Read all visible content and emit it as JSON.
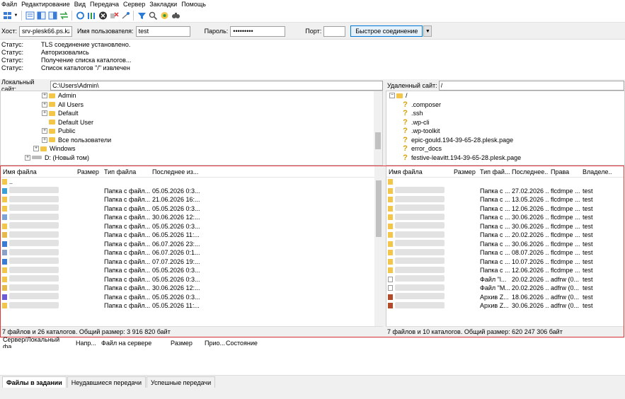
{
  "menu": [
    "Файл",
    "Редактирование",
    "Вид",
    "Передача",
    "Сервер",
    "Закладки",
    "Помощь"
  ],
  "toolbar_icons": [
    "site-manager-icon",
    "dropdown-icon",
    "toggle-log-icon",
    "toggle-local-tree-icon",
    "toggle-remote-tree-icon",
    "queue-icon",
    "refresh-icon",
    "process-queue-icon",
    "cancel-icon",
    "disconnect-icon",
    "reconnect-icon",
    "filter-icon",
    "compare-icon",
    "sync-browse-icon",
    "search-icon"
  ],
  "quickconnect": {
    "host_label": "Хост:",
    "host_value": "srv-plesk66.ps.kz",
    "user_label": "Имя пользователя:",
    "user_value": "test",
    "pass_label": "Пароль:",
    "pass_value": "•••••••••",
    "port_label": "Порт:",
    "port_value": "",
    "button": "Быстрое соединение"
  },
  "log": [
    {
      "k": "Статус:",
      "v": "TLS соединение установлено."
    },
    {
      "k": "Статус:",
      "v": "Авторизовались"
    },
    {
      "k": "Статус:",
      "v": "Получение списка каталогов..."
    },
    {
      "k": "Статус:",
      "v": "Список каталогов \"/\" извлечен"
    }
  ],
  "local": {
    "label": "Локальный сайт:",
    "path": "C:\\Users\\Admin\\",
    "tree": [
      {
        "t": "Admin",
        "indent": 58,
        "exp": "+"
      },
      {
        "t": "All Users",
        "indent": 58,
        "exp": "+"
      },
      {
        "t": "Default",
        "indent": 58,
        "exp": "+"
      },
      {
        "t": "Default User",
        "indent": 58,
        "exp": ""
      },
      {
        "t": "Public",
        "indent": 58,
        "exp": "+"
      },
      {
        "t": "Все пользователи",
        "indent": 58,
        "exp": "+"
      },
      {
        "t": "Windows",
        "indent": 46,
        "exp": "+"
      },
      {
        "t": "D: (Новый том)",
        "indent": 34,
        "exp": "+"
      }
    ],
    "headers": [
      "Имя файла",
      "Размер",
      "Тип файла",
      "Последнее из..."
    ],
    "rows": [
      {
        "type": "",
        "date": ""
      },
      {
        "type": "Папка с файл...",
        "date": "05.05.2026 0:3..."
      },
      {
        "type": "Папка с файл...",
        "date": "21.06.2026 16:..."
      },
      {
        "type": "Папка с файл...",
        "date": "05.05.2026 0:3..."
      },
      {
        "type": "Папка с файл...",
        "date": "30.06.2026 12:..."
      },
      {
        "type": "Папка с файл...",
        "date": "05.05.2026 0:3..."
      },
      {
        "type": "Папка с файл...",
        "date": "06.05.2026 11:..."
      },
      {
        "type": "Папка с файл...",
        "date": "06.07.2026 23:..."
      },
      {
        "type": "Папка с файл...",
        "date": "06.07.2026 0:1..."
      },
      {
        "type": "Папка с файл...",
        "date": "07.07.2026 19:..."
      },
      {
        "type": "Папка с файл...",
        "date": "05.05.2026 0:3..."
      },
      {
        "type": "Папка с файл...",
        "date": "05.05.2026 0:3..."
      },
      {
        "type": "Папка с файл...",
        "date": "30.06.2026 12:..."
      },
      {
        "type": "Папка с файл...",
        "date": "05.05.2026 0:3..."
      },
      {
        "type": "Папка с файл...",
        "date": "05.05.2026 11:..."
      }
    ],
    "first_row_name": "..",
    "summary": "7 файлов и 26 каталогов. Общий размер: 3 916 820 байт"
  },
  "remote": {
    "label": "Удаленный сайт:",
    "path": "/",
    "tree": [
      {
        "t": "/",
        "q": false
      },
      {
        "t": ".composer",
        "q": true
      },
      {
        "t": ".ssh",
        "q": true
      },
      {
        "t": ".wp-cli",
        "q": true
      },
      {
        "t": ".wp-toolkit",
        "q": true
      },
      {
        "t": "epic-gould.194-39-65-28.plesk.page",
        "q": true
      },
      {
        "t": "error_docs",
        "q": true
      },
      {
        "t": "festive-leavitt.194-39-65-28.plesk.page",
        "q": true
      }
    ],
    "headers": [
      "Имя файла",
      "Размер",
      "Тип фай...",
      "Последнее...",
      "Права",
      "Владеле..."
    ],
    "rows": [
      {
        "type": "",
        "date": "",
        "perm": "",
        "own": ""
      },
      {
        "type": "Папка с ...",
        "date": "27.02.2026 ...",
        "perm": "flcdmpe ...",
        "own": "test"
      },
      {
        "type": "Папка с ...",
        "date": "13.05.2026 ...",
        "perm": "flcdmpe ...",
        "own": "test"
      },
      {
        "type": "Папка с ...",
        "date": "12.06.2026 ...",
        "perm": "flcdmpe ...",
        "own": "test"
      },
      {
        "type": "Папка с ...",
        "date": "30.06.2026 ...",
        "perm": "flcdmpe ...",
        "own": "test"
      },
      {
        "type": "Папка с ...",
        "date": "30.06.2026 ...",
        "perm": "flcdmpe ...",
        "own": "test"
      },
      {
        "type": "Папка с ...",
        "date": "20.02.2026 ...",
        "perm": "flcdmpe ...",
        "own": "test"
      },
      {
        "type": "Папка с ...",
        "date": "30.06.2026 ...",
        "perm": "flcdmpe ...",
        "own": "test"
      },
      {
        "type": "Папка с ...",
        "date": "08.07.2026 ...",
        "perm": "flcdmpe ...",
        "own": "test"
      },
      {
        "type": "Папка с ...",
        "date": "10.07.2026 ...",
        "perm": "flcdmpe ...",
        "own": "test"
      },
      {
        "type": "Папка с ...",
        "date": "12.06.2026 ...",
        "perm": "flcdmpe ...",
        "own": "test"
      },
      {
        "type": "Файл \"l...",
        "date": "20.02.2026 ...",
        "perm": "adfrw (0...",
        "own": "test"
      },
      {
        "type": "Файл \"M...",
        "date": "20.02.2026 ...",
        "perm": "adfrw (0...",
        "own": "test"
      },
      {
        "type": "Архив Z...",
        "date": "18.06.2026 ...",
        "perm": "adfrw (0...",
        "own": "test"
      },
      {
        "type": "Архив Z...",
        "date": "30.06.2026 ...",
        "perm": "adfrw (0...",
        "own": "test"
      }
    ],
    "summary": "7 файлов и 10 каталогов. Общий размер: 620 247 306 байт"
  },
  "queue_headers": [
    "Сервер/Локальный фа...",
    "Напр...",
    "Файл на сервере",
    "Размер",
    "Прио...",
    "Состояние"
  ],
  "tabs": [
    "Файлы в задании",
    "Неудавшиеся передачи",
    "Успешные передачи"
  ],
  "colors": {
    "highlight_border": "#e0383b",
    "folder": "#f3c649"
  }
}
